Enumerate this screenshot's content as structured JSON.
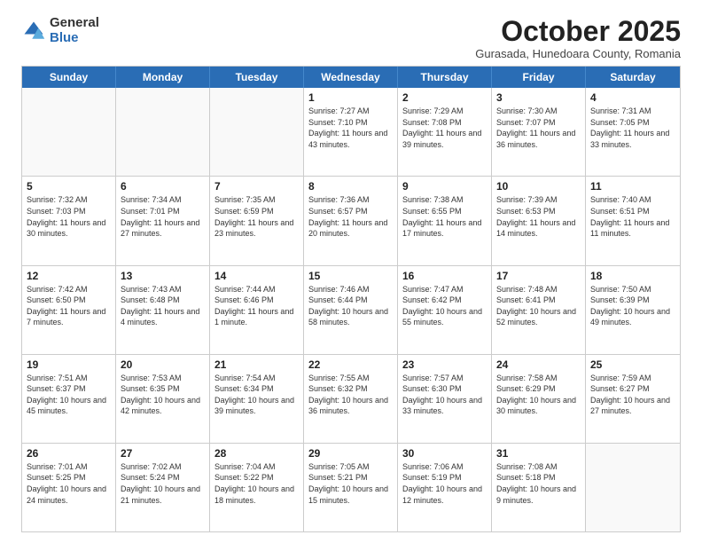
{
  "logo": {
    "general": "General",
    "blue": "Blue"
  },
  "title": "October 2025",
  "subtitle": "Gurasada, Hunedoara County, Romania",
  "weekdays": [
    "Sunday",
    "Monday",
    "Tuesday",
    "Wednesday",
    "Thursday",
    "Friday",
    "Saturday"
  ],
  "weeks": [
    [
      {
        "day": "",
        "empty": true
      },
      {
        "day": "",
        "empty": true
      },
      {
        "day": "",
        "empty": true
      },
      {
        "day": "1",
        "sunrise": "7:27 AM",
        "sunset": "7:10 PM",
        "daylight": "11 hours and 43 minutes."
      },
      {
        "day": "2",
        "sunrise": "7:29 AM",
        "sunset": "7:08 PM",
        "daylight": "11 hours and 39 minutes."
      },
      {
        "day": "3",
        "sunrise": "7:30 AM",
        "sunset": "7:07 PM",
        "daylight": "11 hours and 36 minutes."
      },
      {
        "day": "4",
        "sunrise": "7:31 AM",
        "sunset": "7:05 PM",
        "daylight": "11 hours and 33 minutes."
      }
    ],
    [
      {
        "day": "5",
        "sunrise": "7:32 AM",
        "sunset": "7:03 PM",
        "daylight": "11 hours and 30 minutes."
      },
      {
        "day": "6",
        "sunrise": "7:34 AM",
        "sunset": "7:01 PM",
        "daylight": "11 hours and 27 minutes."
      },
      {
        "day": "7",
        "sunrise": "7:35 AM",
        "sunset": "6:59 PM",
        "daylight": "11 hours and 23 minutes."
      },
      {
        "day": "8",
        "sunrise": "7:36 AM",
        "sunset": "6:57 PM",
        "daylight": "11 hours and 20 minutes."
      },
      {
        "day": "9",
        "sunrise": "7:38 AM",
        "sunset": "6:55 PM",
        "daylight": "11 hours and 17 minutes."
      },
      {
        "day": "10",
        "sunrise": "7:39 AM",
        "sunset": "6:53 PM",
        "daylight": "11 hours and 14 minutes."
      },
      {
        "day": "11",
        "sunrise": "7:40 AM",
        "sunset": "6:51 PM",
        "daylight": "11 hours and 11 minutes."
      }
    ],
    [
      {
        "day": "12",
        "sunrise": "7:42 AM",
        "sunset": "6:50 PM",
        "daylight": "11 hours and 7 minutes."
      },
      {
        "day": "13",
        "sunrise": "7:43 AM",
        "sunset": "6:48 PM",
        "daylight": "11 hours and 4 minutes."
      },
      {
        "day": "14",
        "sunrise": "7:44 AM",
        "sunset": "6:46 PM",
        "daylight": "11 hours and 1 minute."
      },
      {
        "day": "15",
        "sunrise": "7:46 AM",
        "sunset": "6:44 PM",
        "daylight": "10 hours and 58 minutes."
      },
      {
        "day": "16",
        "sunrise": "7:47 AM",
        "sunset": "6:42 PM",
        "daylight": "10 hours and 55 minutes."
      },
      {
        "day": "17",
        "sunrise": "7:48 AM",
        "sunset": "6:41 PM",
        "daylight": "10 hours and 52 minutes."
      },
      {
        "day": "18",
        "sunrise": "7:50 AM",
        "sunset": "6:39 PM",
        "daylight": "10 hours and 49 minutes."
      }
    ],
    [
      {
        "day": "19",
        "sunrise": "7:51 AM",
        "sunset": "6:37 PM",
        "daylight": "10 hours and 45 minutes."
      },
      {
        "day": "20",
        "sunrise": "7:53 AM",
        "sunset": "6:35 PM",
        "daylight": "10 hours and 42 minutes."
      },
      {
        "day": "21",
        "sunrise": "7:54 AM",
        "sunset": "6:34 PM",
        "daylight": "10 hours and 39 minutes."
      },
      {
        "day": "22",
        "sunrise": "7:55 AM",
        "sunset": "6:32 PM",
        "daylight": "10 hours and 36 minutes."
      },
      {
        "day": "23",
        "sunrise": "7:57 AM",
        "sunset": "6:30 PM",
        "daylight": "10 hours and 33 minutes."
      },
      {
        "day": "24",
        "sunrise": "7:58 AM",
        "sunset": "6:29 PM",
        "daylight": "10 hours and 30 minutes."
      },
      {
        "day": "25",
        "sunrise": "7:59 AM",
        "sunset": "6:27 PM",
        "daylight": "10 hours and 27 minutes."
      }
    ],
    [
      {
        "day": "26",
        "sunrise": "7:01 AM",
        "sunset": "5:25 PM",
        "daylight": "10 hours and 24 minutes."
      },
      {
        "day": "27",
        "sunrise": "7:02 AM",
        "sunset": "5:24 PM",
        "daylight": "10 hours and 21 minutes."
      },
      {
        "day": "28",
        "sunrise": "7:04 AM",
        "sunset": "5:22 PM",
        "daylight": "10 hours and 18 minutes."
      },
      {
        "day": "29",
        "sunrise": "7:05 AM",
        "sunset": "5:21 PM",
        "daylight": "10 hours and 15 minutes."
      },
      {
        "day": "30",
        "sunrise": "7:06 AM",
        "sunset": "5:19 PM",
        "daylight": "10 hours and 12 minutes."
      },
      {
        "day": "31",
        "sunrise": "7:08 AM",
        "sunset": "5:18 PM",
        "daylight": "10 hours and 9 minutes."
      },
      {
        "day": "",
        "empty": true
      }
    ]
  ]
}
